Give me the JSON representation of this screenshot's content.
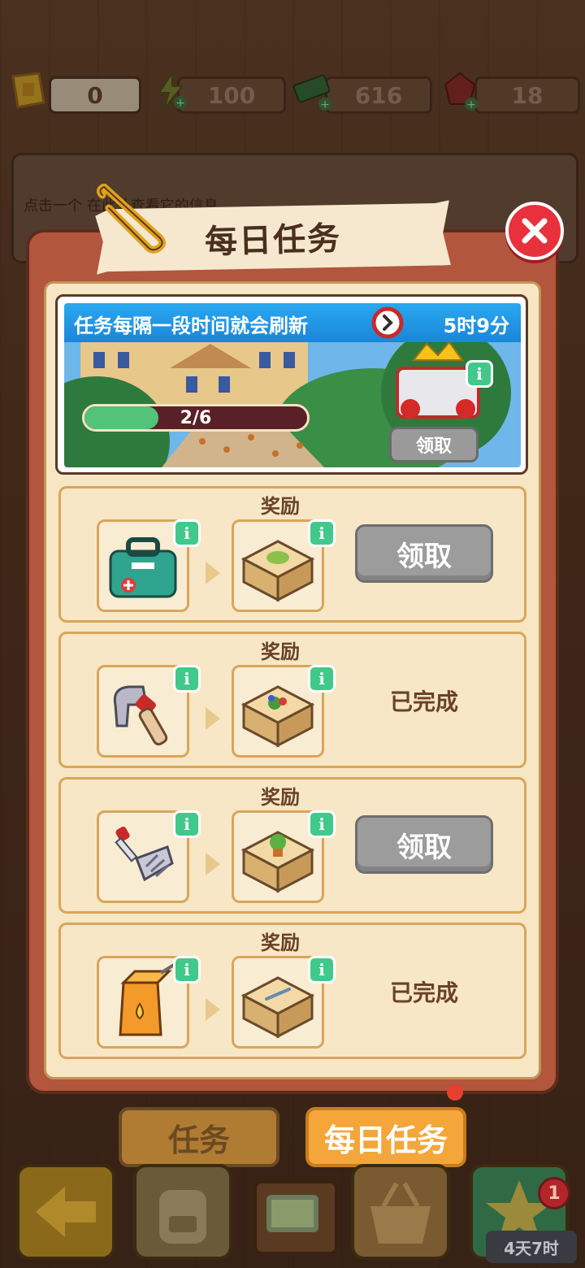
{
  "resources": {
    "tickets": "0",
    "energy": "100",
    "cash": "616",
    "gems": "18"
  },
  "info_card": {
    "text": "点击一个    在此处查看它的信息"
  },
  "dialog": {
    "title": "每日任务",
    "refresh": {
      "text": "任务每隔一段时间就会刷新",
      "timer": "5时9分",
      "progress_label": "2/6",
      "progress_fraction": 0.333,
      "claim_label": "领取"
    },
    "tasks": [
      {
        "reward_label": "奖励",
        "item_icon": "first-aid-kit-icon",
        "reward_icon": "sandwich-box-icon",
        "action": "领取",
        "status": "claim"
      },
      {
        "reward_label": "奖励",
        "item_icon": "hammer-icon",
        "reward_icon": "salad-box-icon",
        "action": "已完成",
        "status": "done"
      },
      {
        "reward_label": "奖励",
        "item_icon": "rake-icon",
        "reward_icon": "plant-box-icon",
        "action": "领取",
        "status": "claim"
      },
      {
        "reward_label": "奖励",
        "item_icon": "juice-box-icon",
        "reward_icon": "thermometer-box-icon",
        "action": "已完成",
        "status": "done"
      }
    ],
    "info_symbol": "i"
  },
  "tabs": {
    "tasks": "任务",
    "daily": "每日任务"
  },
  "bottom": {
    "badge_count": "1",
    "timer": "4天7时"
  },
  "colors": {
    "accent_blue": "#2aa8f0",
    "progress_green": "#54c37a",
    "info_green": "#41c98b",
    "close_red": "#e8313c",
    "tab_active": "#f4a63a"
  }
}
